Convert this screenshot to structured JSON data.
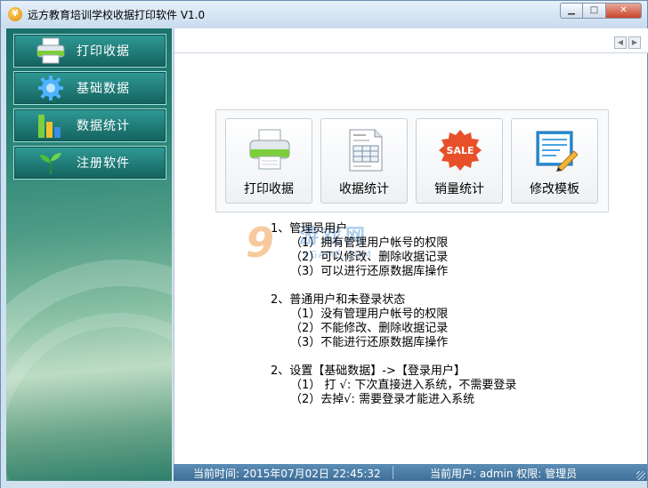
{
  "window": {
    "title": "远方教育培训学校收据打印软件 V1.0",
    "app_icon_glyph": "¥",
    "minimize_glyph": "▁",
    "maximize_glyph": "□",
    "close_glyph": "✕"
  },
  "sidebar": {
    "items": [
      {
        "label": "打印收据",
        "icon": "printer-icon"
      },
      {
        "label": "基础数据",
        "icon": "gear-icon"
      },
      {
        "label": "数据统计",
        "icon": "bar-chart-icon"
      },
      {
        "label": "注册软件",
        "icon": "sprout-icon"
      }
    ]
  },
  "toolbar": {
    "scroll_left": "◀",
    "scroll_right": "▶",
    "tools": [
      {
        "label": "打印收据",
        "icon": "printer-icon"
      },
      {
        "label": "收据统计",
        "icon": "document-icon"
      },
      {
        "label": "销量统计",
        "icon": "sale-badge-icon",
        "badge_text": "SALE"
      },
      {
        "label": "修改模板",
        "icon": "edit-template-icon"
      }
    ]
  },
  "info": {
    "lines": [
      "1、管理员用户",
      "（1）拥有管理用户帐号的权限",
      "（2）可以修改、删除收据记录",
      "（3）可以进行还原数据库操作",
      "2、普通用户和未登录状态",
      "（1）没有管理用户帐号的权限",
      "（2）不能修改、删除收据记录",
      "（3）不能进行还原数据库操作",
      "2、设置【基础数据】->【登录用户】",
      "（1） 打 √: 下次直接进入系统，不需要登录",
      "（2）去掉√: 需要登录才能进入系统"
    ]
  },
  "watermark": {
    "number": "9",
    "text": "游戏网",
    "sub": "9GAME.COM"
  },
  "status": {
    "time": "当前时间: 2015年07月02日 22:45:32",
    "user": "当前用户: admin   权限: 管理员"
  },
  "colors": {
    "accent_teal": "#14625e",
    "status_blue": "#3f6f98"
  }
}
